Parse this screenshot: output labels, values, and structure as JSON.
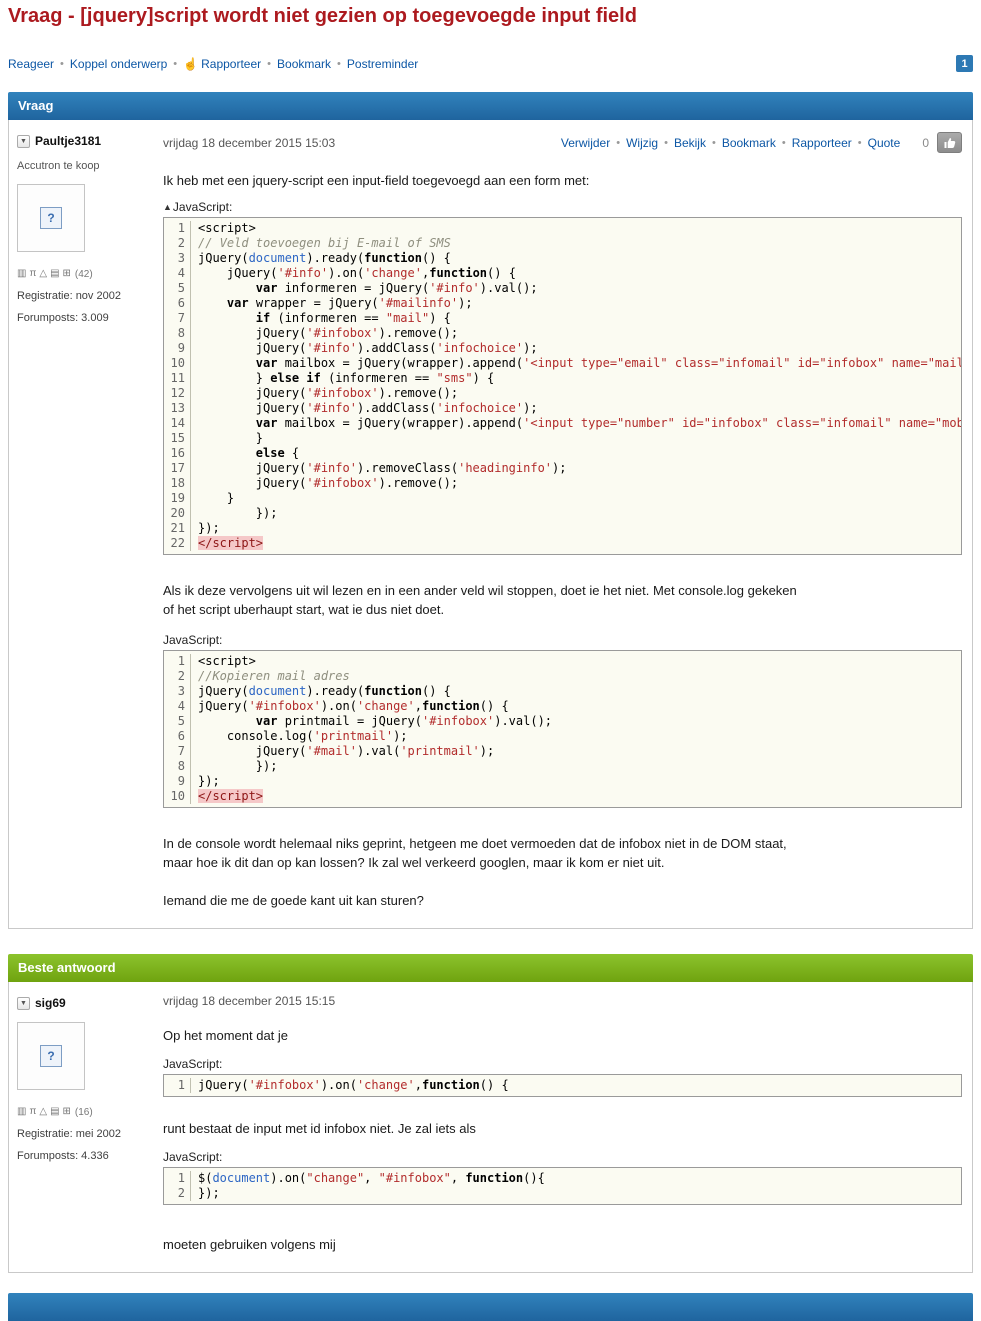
{
  "ui": {
    "bullet": "•",
    "report_hand_icon": "☝",
    "collapse_arrow": "▲",
    "dropdown_arrow": "▼",
    "avatar_placeholder": "?",
    "badge_glyphs": [
      "▥",
      "π",
      "△",
      "▤",
      "⊞"
    ]
  },
  "colors": {
    "title_red": "#ac1a1f",
    "link_blue": "#0d57a5",
    "question_bar_blue": "#2a76b0",
    "answer_bar_green": "#7cb31e",
    "code_string_red": "#b22c2c",
    "code_builtin_blue": "#2d66c4"
  },
  "page": {
    "title": "Vraag - [jquery]script wordt niet gezien op toegevoegde input field",
    "actions": [
      "Reageer",
      "Koppel onderwerp",
      "Rapporteer",
      "Bookmark",
      "Postreminder"
    ],
    "page_number": "1"
  },
  "question_section": {
    "header": "Vraag"
  },
  "answer_section": {
    "header": "Beste antwoord"
  },
  "post1": {
    "author": "Paultje3181",
    "tagline": "Accutron te koop",
    "badge_count": "(42)",
    "registration": "Registratie: nov 2002",
    "forumposts": "Forumposts: 3.009",
    "date": "vrijdag 18 december 2015 15:03",
    "actions": [
      "Verwijder",
      "Wijzig",
      "Bekijk",
      "Bookmark",
      "Rapporteer",
      "Quote"
    ],
    "score": "0",
    "paragraphs": {
      "intro": [
        "Ik heb met een jquery-script een input-field toegevoegd aan een form met:"
      ],
      "middle": [
        "Als ik deze vervolgens uit wil lezen en in een ander veld wil stoppen, doet ie het niet. Met console.log gekeken",
        "of het script uberhaupt start, wat ie dus niet doet."
      ],
      "conclusion": [
        "In de console wordt helemaal niks geprint, hetgeen me doet vermoeden dat de infobox niet in de DOM staat,",
        "maar hoe ik dit dan op kan lossen? Ik zal wel verkeerd googlen, maar ik kom er niet uit."
      ],
      "question": [
        "Iemand die me de goede kant uit kan sturen?"
      ]
    }
  },
  "post2": {
    "author": "sig69",
    "badge_count": "(16)",
    "registration": "Registratie: mei 2002",
    "forumposts": "Forumposts: 4.336",
    "date": "vrijdag 18 december 2015 15:15",
    "paragraphs": {
      "p1": [
        "Op het moment dat je"
      ],
      "p2": [
        "runt bestaat de input met id infobox niet. Je zal iets als"
      ],
      "p3": [
        "moeten gebruiken volgens mij"
      ]
    }
  },
  "code_blocks": {
    "code1": {
      "label": "JavaScript:",
      "lines": [
        [
          [
            "p",
            "<script>"
          ]
        ],
        [
          [
            "c",
            "// Veld toevoegen bij E-mail of SMS"
          ]
        ],
        [
          [
            "p",
            "jQuery("
          ],
          [
            "d",
            "document"
          ],
          [
            "p",
            ").ready("
          ],
          [
            "k",
            "function"
          ],
          [
            "p",
            "() {"
          ]
        ],
        [
          [
            "p",
            "    jQuery("
          ],
          [
            "s",
            "'#info'"
          ],
          [
            "p",
            ").on("
          ],
          [
            "s",
            "'change'"
          ],
          [
            "p",
            ","
          ],
          [
            "k",
            "function"
          ],
          [
            "p",
            "() {"
          ]
        ],
        [
          [
            "p",
            "        "
          ],
          [
            "k",
            "var"
          ],
          [
            "p",
            " informeren = jQuery("
          ],
          [
            "s",
            "'#info'"
          ],
          [
            "p",
            ").val();"
          ]
        ],
        [
          [
            "p",
            "    "
          ],
          [
            "k",
            "var"
          ],
          [
            "p",
            " wrapper = jQuery("
          ],
          [
            "s",
            "'#mailinfo'"
          ],
          [
            "p",
            ");"
          ]
        ],
        [
          [
            "p",
            "        "
          ],
          [
            "k",
            "if"
          ],
          [
            "p",
            " (informeren == "
          ],
          [
            "s",
            "\"mail\""
          ],
          [
            "p",
            ") {"
          ]
        ],
        [
          [
            "p",
            "        jQuery("
          ],
          [
            "s",
            "'#infobox'"
          ],
          [
            "p",
            ").remove();"
          ]
        ],
        [
          [
            "p",
            "        jQuery("
          ],
          [
            "s",
            "'#info'"
          ],
          [
            "p",
            ").addClass("
          ],
          [
            "s",
            "'infochoice'"
          ],
          [
            "p",
            ");"
          ]
        ],
        [
          [
            "p",
            "        "
          ],
          [
            "k",
            "var"
          ],
          [
            "p",
            " mailbox = jQuery(wrapper).append("
          ],
          [
            "s",
            "'<input type=\"email\" class=\"infomail\" id=\"infobox\" name=\"mail"
          ]
        ],
        [
          [
            "p",
            "        } "
          ],
          [
            "k",
            "else"
          ],
          [
            "p",
            " "
          ],
          [
            "k",
            "if"
          ],
          [
            "p",
            " (informeren == "
          ],
          [
            "s",
            "\"sms\""
          ],
          [
            "p",
            ") {"
          ]
        ],
        [
          [
            "p",
            "        jQuery("
          ],
          [
            "s",
            "'#infobox'"
          ],
          [
            "p",
            ").remove();"
          ]
        ],
        [
          [
            "p",
            "        jQuery("
          ],
          [
            "s",
            "'#info'"
          ],
          [
            "p",
            ").addClass("
          ],
          [
            "s",
            "'infochoice'"
          ],
          [
            "p",
            ");"
          ]
        ],
        [
          [
            "p",
            "        "
          ],
          [
            "k",
            "var"
          ],
          [
            "p",
            " mailbox = jQuery(wrapper).append("
          ],
          [
            "s",
            "'<input type=\"number\" id=\"infobox\" class=\"infomail\" name=\"mob"
          ]
        ],
        [
          [
            "p",
            "        }"
          ]
        ],
        [
          [
            "p",
            "        "
          ],
          [
            "k",
            "else"
          ],
          [
            "p",
            " {"
          ]
        ],
        [
          [
            "p",
            "        jQuery("
          ],
          [
            "s",
            "'#info'"
          ],
          [
            "p",
            ").removeClass("
          ],
          [
            "s",
            "'headinginfo'"
          ],
          [
            "p",
            ");"
          ]
        ],
        [
          [
            "p",
            "        jQuery("
          ],
          [
            "s",
            "'#infobox'"
          ],
          [
            "p",
            ").remove();"
          ]
        ],
        [
          [
            "p",
            "    }"
          ]
        ],
        [
          [
            "p",
            "        });"
          ]
        ],
        [
          [
            "p",
            "});"
          ]
        ],
        [
          [
            "e",
            "</script>"
          ]
        ]
      ]
    },
    "code2": {
      "label": "JavaScript:",
      "lines": [
        [
          [
            "p",
            "<script>"
          ]
        ],
        [
          [
            "c",
            "//Kopieren mail adres"
          ]
        ],
        [
          [
            "p",
            "jQuery("
          ],
          [
            "d",
            "document"
          ],
          [
            "p",
            ").ready("
          ],
          [
            "k",
            "function"
          ],
          [
            "p",
            "() {"
          ]
        ],
        [
          [
            "p",
            "jQuery("
          ],
          [
            "s",
            "'#infobox'"
          ],
          [
            "p",
            ").on("
          ],
          [
            "s",
            "'change'"
          ],
          [
            "p",
            ","
          ],
          [
            "k",
            "function"
          ],
          [
            "p",
            "() {"
          ]
        ],
        [
          [
            "p",
            "        "
          ],
          [
            "k",
            "var"
          ],
          [
            "p",
            " printmail = jQuery("
          ],
          [
            "s",
            "'#infobox'"
          ],
          [
            "p",
            ").val();"
          ]
        ],
        [
          [
            "p",
            "    console.log("
          ],
          [
            "s",
            "'printmail'"
          ],
          [
            "p",
            ");"
          ]
        ],
        [
          [
            "p",
            "        jQuery("
          ],
          [
            "s",
            "'#mail'"
          ],
          [
            "p",
            ").val("
          ],
          [
            "s",
            "'printmail'"
          ],
          [
            "p",
            ");"
          ]
        ],
        [
          [
            "p",
            "        });"
          ]
        ],
        [
          [
            "p",
            "});"
          ]
        ],
        [
          [
            "e",
            "</script>"
          ]
        ]
      ]
    },
    "code3": {
      "label": "JavaScript:",
      "lines": [
        [
          [
            "p",
            "jQuery("
          ],
          [
            "s",
            "'#infobox'"
          ],
          [
            "p",
            ").on("
          ],
          [
            "s",
            "'change'"
          ],
          [
            "p",
            ","
          ],
          [
            "k",
            "function"
          ],
          [
            "p",
            "() {"
          ]
        ]
      ]
    },
    "code4": {
      "label": "JavaScript:",
      "lines": [
        [
          [
            "p",
            "$("
          ],
          [
            "d",
            "document"
          ],
          [
            "p",
            ").on("
          ],
          [
            "s",
            "\"change\""
          ],
          [
            "p",
            ", "
          ],
          [
            "s",
            "\"#infobox\""
          ],
          [
            "p",
            ", "
          ],
          [
            "k",
            "function"
          ],
          [
            "p",
            "(){"
          ]
        ],
        [
          [
            "p",
            "});"
          ]
        ]
      ]
    }
  }
}
